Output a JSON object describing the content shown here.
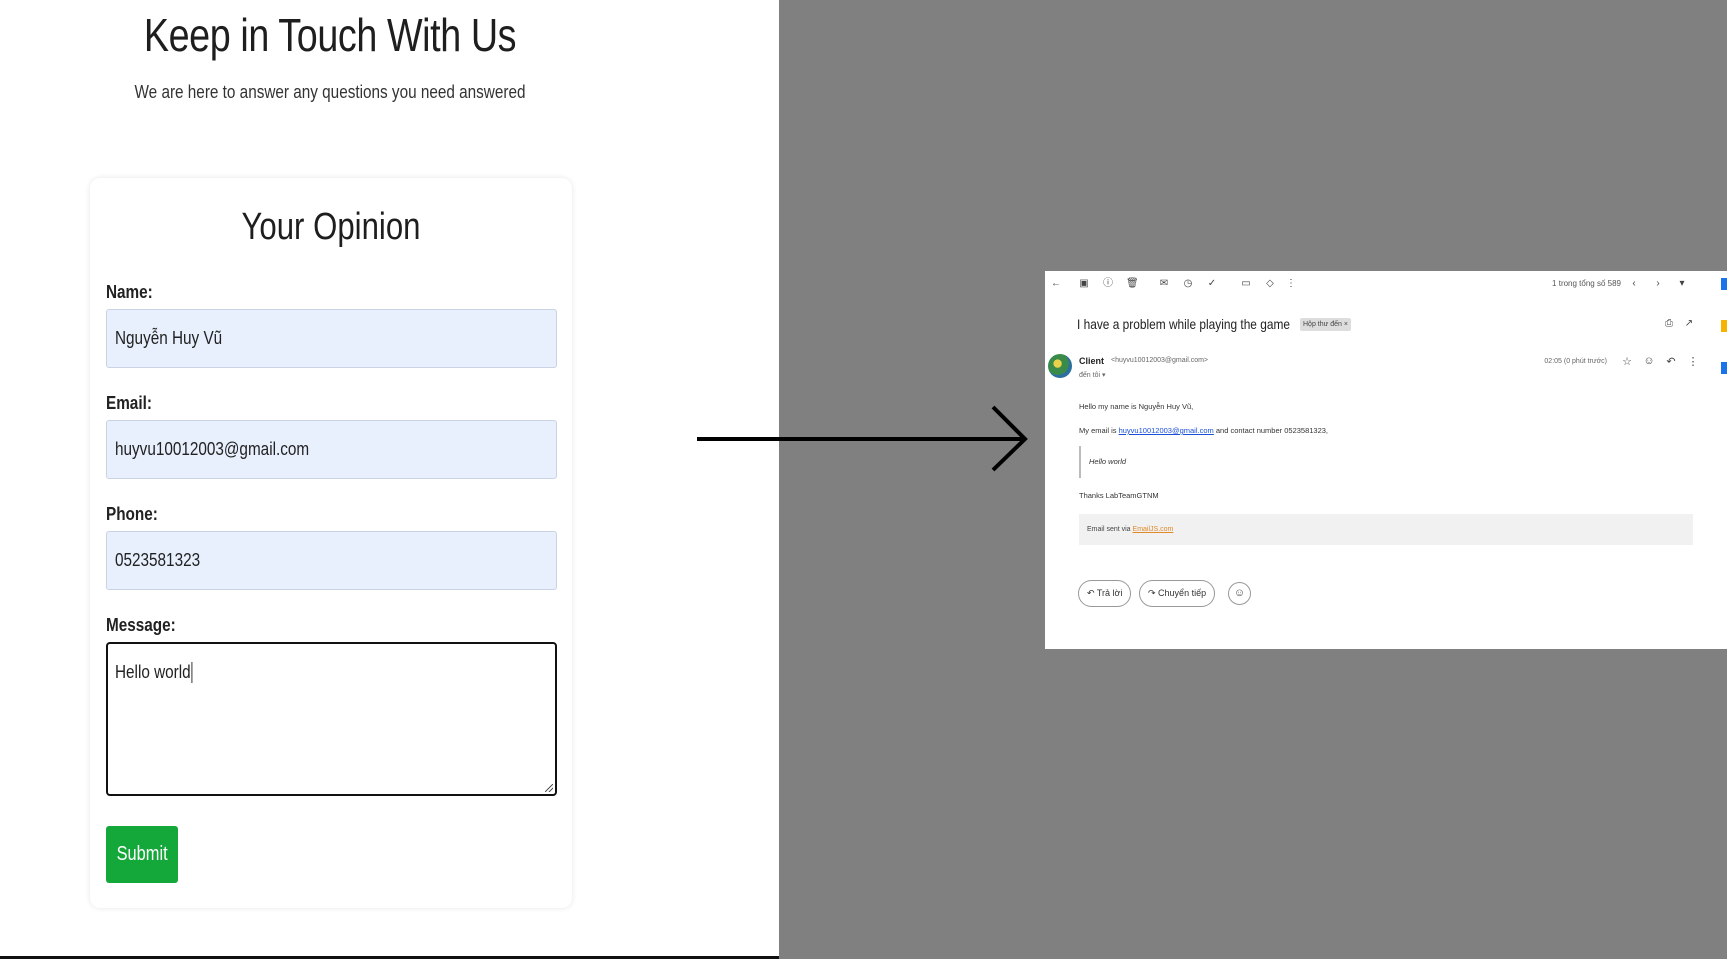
{
  "form_page": {
    "title": "Keep in Touch With Us",
    "subtitle": "We are here to answer any questions you need answered",
    "card_title": "Your Opinion",
    "fields": {
      "name": {
        "label": "Name:",
        "value": "Nguyễn Huy Vũ"
      },
      "email": {
        "label": "Email:",
        "value": "huyvu10012003@gmail.com"
      },
      "phone": {
        "label": "Phone:",
        "value": "0523581323"
      },
      "message": {
        "label": "Message:",
        "value": "Hello world"
      }
    },
    "submit_label": "Submit"
  },
  "email_view": {
    "toolbar": {
      "counter": "1 trong tổng số 589",
      "icons": [
        "back-arrow-icon",
        "archive-icon",
        "report-spam-icon",
        "delete-icon",
        "mark-unread-icon",
        "snooze-icon",
        "add-task-icon",
        "move-to-icon",
        "label-icon",
        "more-icon",
        "prev-icon",
        "next-icon",
        "settings-icon"
      ]
    },
    "subject": "I have a problem while playing the game",
    "inbox_chip": "Hộp thư đến ×",
    "sender": {
      "name": "Client",
      "email": "<huyvu10012003@gmail.com>",
      "to": "đến tôi ▾",
      "timestamp": "02:05 (0 phút trước)"
    },
    "body": {
      "line1": "Hello my name is Nguyễn Huy Vũ,",
      "line2_prefix": "My email is ",
      "line2_link": "huyvu10012003@gmail.com",
      "line2_suffix": " and contact number 0523581323,",
      "quote": "Hello world",
      "thanks": "Thanks LabTeamGTNM",
      "footer_prefix": "Email sent via ",
      "footer_link": "EmailJS.com"
    },
    "actions": {
      "reply": "Trả lời",
      "forward": "Chuyển tiếp"
    }
  },
  "colors": {
    "submit": "#14a83a",
    "input_bg": "#e8f0fe",
    "right_bg": "#808080",
    "link": "#1a4fd6",
    "footer_link": "#e08a2a"
  }
}
